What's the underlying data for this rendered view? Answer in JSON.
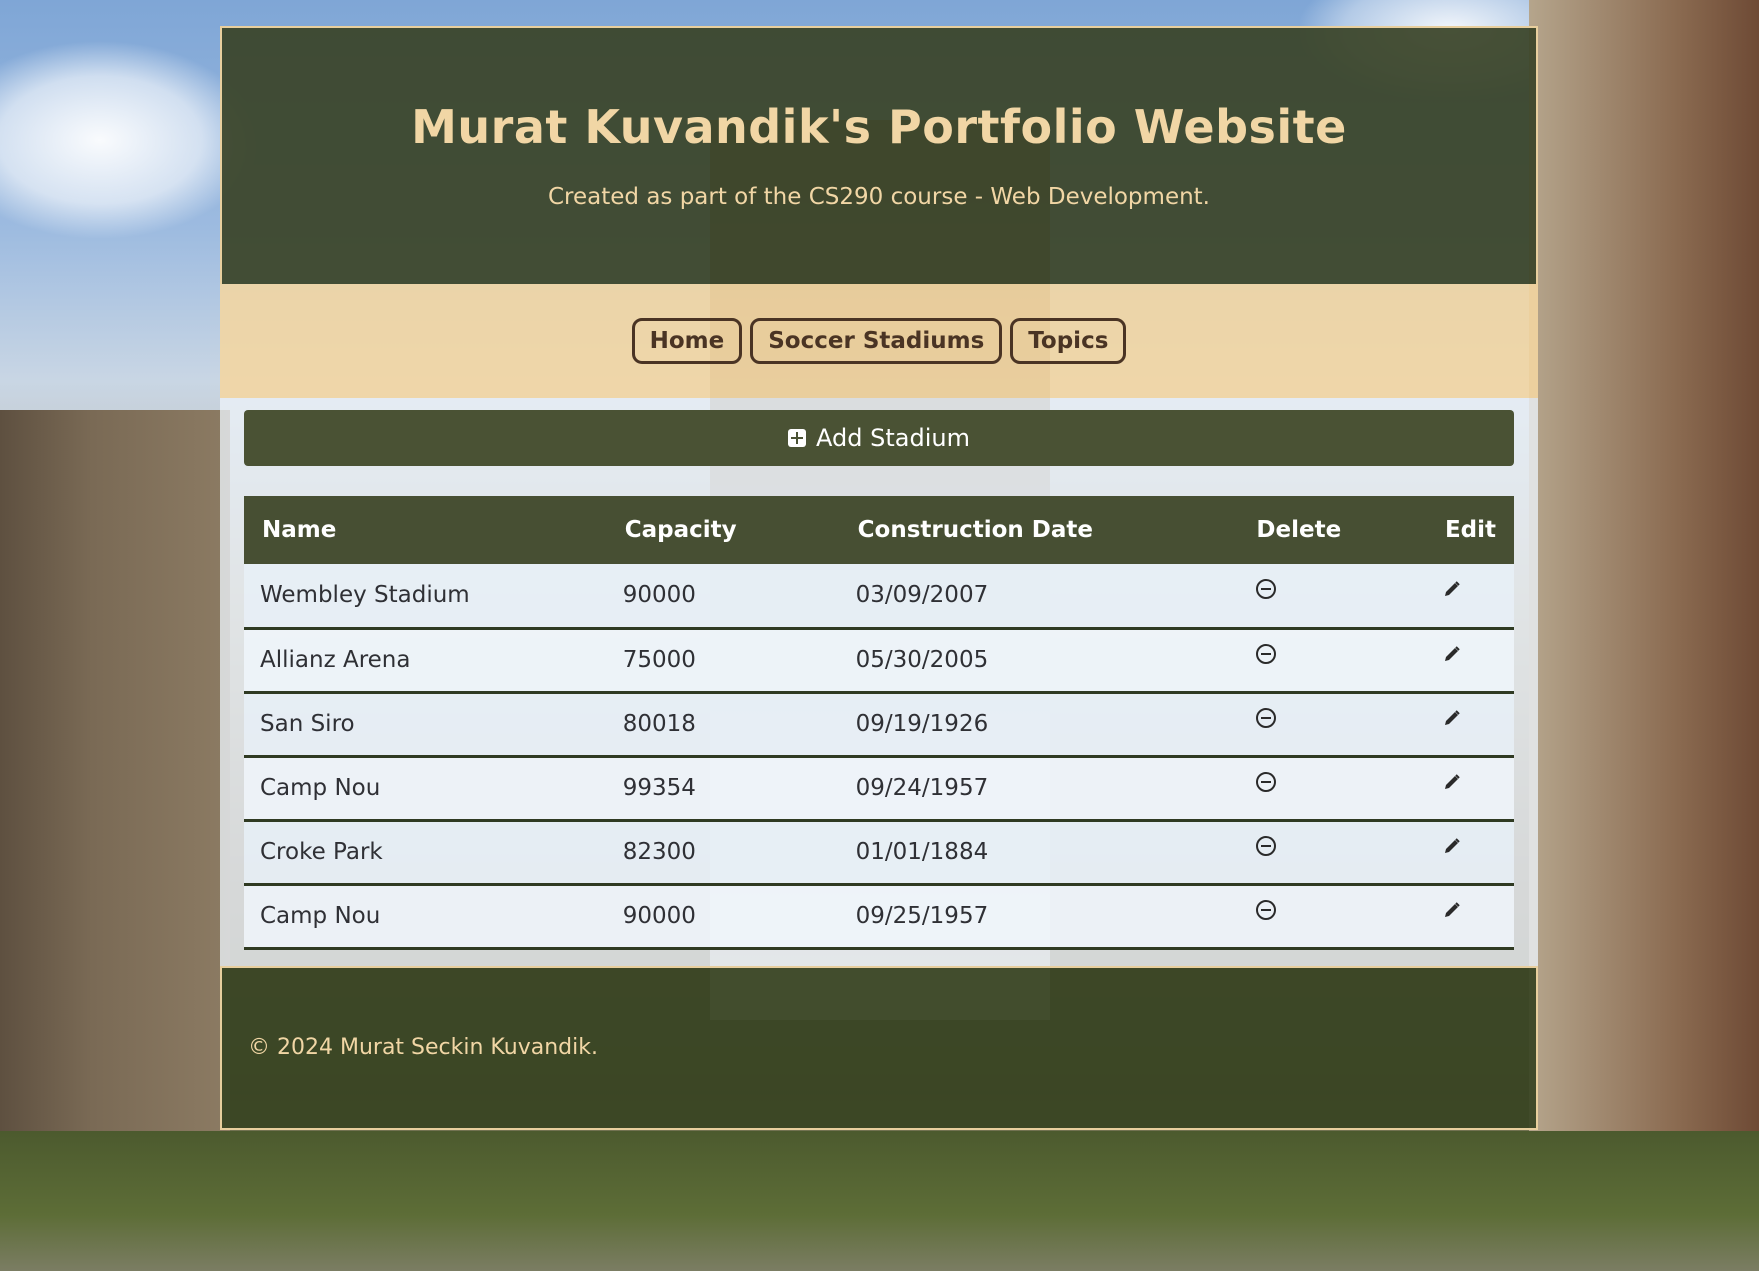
{
  "header": {
    "title": "Murat Kuvandik's Portfolio Website",
    "subtitle": "Created as part of the CS290 course - Web Development."
  },
  "nav": {
    "items": [
      {
        "label": "Home"
      },
      {
        "label": "Soccer Stadiums"
      },
      {
        "label": "Topics"
      }
    ]
  },
  "actions": {
    "add_label": "Add Stadium",
    "add_icon": "plus-square-icon"
  },
  "table": {
    "headers": [
      "Name",
      "Capacity",
      "Construction Date",
      "Delete",
      "Edit"
    ],
    "rows": [
      {
        "name": "Wembley Stadium",
        "capacity": "90000",
        "date": "03/09/2007"
      },
      {
        "name": "Allianz Arena",
        "capacity": "75000",
        "date": "05/30/2005"
      },
      {
        "name": "San Siro",
        "capacity": "80018",
        "date": "09/19/1926"
      },
      {
        "name": "Camp Nou",
        "capacity": "99354",
        "date": "09/24/1957"
      },
      {
        "name": "Croke Park",
        "capacity": "82300",
        "date": "01/01/1884"
      },
      {
        "name": "Camp Nou",
        "capacity": "90000",
        "date": "09/25/1957"
      }
    ],
    "delete_icon": "minus-circle-icon",
    "edit_icon": "pencil-icon"
  },
  "footer": {
    "text": "© 2024 Murat Seckin Kuvandik."
  },
  "colors": {
    "header_bg": "#3a4428",
    "title_text": "#f1d6a5",
    "nav_bg": "#f4d6a0",
    "nav_text": "#4a3424",
    "button_bg": "#4a5234"
  }
}
